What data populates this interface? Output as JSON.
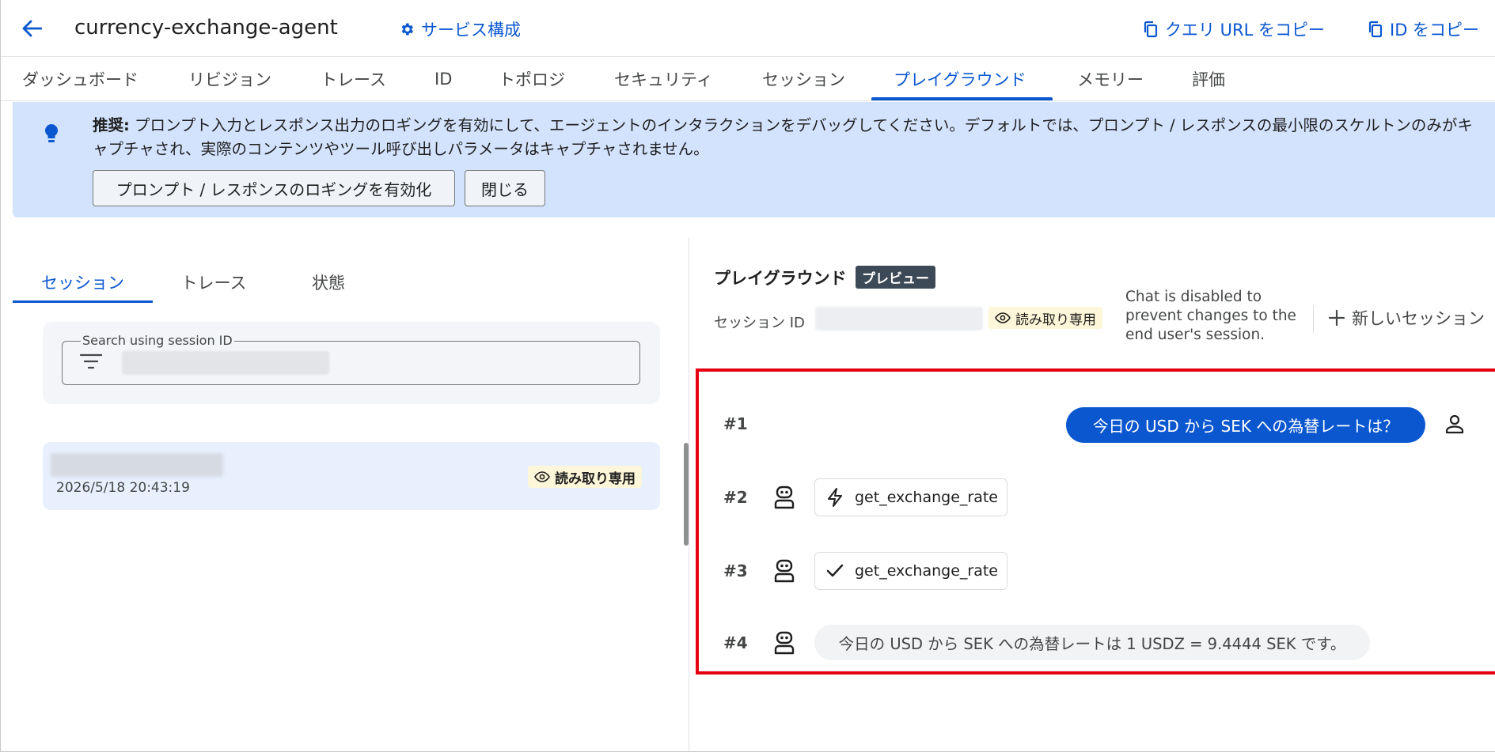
{
  "header": {
    "back_icon": "arrow-back-icon",
    "title": "currency-exchange-agent",
    "service_config": {
      "icon": "gear-icon",
      "label": "サービス構成"
    },
    "copy_query_url": {
      "icon": "copy-icon",
      "label": "クエリ URL をコピー"
    },
    "copy_id": {
      "icon": "copy-icon",
      "label": "ID をコピー"
    }
  },
  "tabs": [
    {
      "label": "ダッシュボード"
    },
    {
      "label": "リビジョン"
    },
    {
      "label": "トレース"
    },
    {
      "label": "ID"
    },
    {
      "label": "トポロジ"
    },
    {
      "label": "セキュリティ"
    },
    {
      "label": "セッション"
    },
    {
      "label": "プレイグラウンド",
      "active": true
    },
    {
      "label": "メモリー"
    },
    {
      "label": "評価"
    }
  ],
  "banner": {
    "icon": "lightbulb-icon",
    "lead": "推奨:",
    "text": " プロンプト入力とレスポンス出力のロギングを有効にして、エージェントのインタラクションをデバッグしてください。デフォルトでは、プロンプト / レスポンスの最小限のスケルトンのみがキャプチャされ、実際のコンテンツやツール呼び出しパラメータはキャプチャされません。",
    "enable_button": "プロンプト / レスポンスのロギングを有効化",
    "close_button": "閉じる"
  },
  "left": {
    "tabs": [
      {
        "label": "セッション",
        "active": true
      },
      {
        "label": "トレース"
      },
      {
        "label": "状態"
      }
    ],
    "search": {
      "label": "Search using session ID",
      "icon": "filter-icon",
      "value": ""
    },
    "sessions": [
      {
        "time": "2026/5/18 20:43:19",
        "badge": "読み取り専用",
        "badge_icon": "eye-icon"
      }
    ]
  },
  "right": {
    "title": "プレイグラウンド",
    "preview_badge": "プレビュー",
    "session_id_label": "セッション ID",
    "read_only_badge": "読み取り専用",
    "read_only_icon": "eye-icon",
    "chat_disabled": "Chat is disabled to prevent changes to the end user's session.",
    "new_session": {
      "icon": "plus-icon",
      "label": "新しいセッション"
    },
    "highlight_color": "#e50012",
    "turns": [
      {
        "num": "#1",
        "role": "user",
        "text": "今日の USD から SEK への為替レートは？"
      },
      {
        "num": "#2",
        "role": "agent",
        "type": "tool_call",
        "icon": "bolt-icon",
        "text": "get_exchange_rate"
      },
      {
        "num": "#3",
        "role": "agent",
        "type": "tool_result",
        "icon": "check-icon",
        "text": "get_exchange_rate"
      },
      {
        "num": "#4",
        "role": "agent",
        "type": "text",
        "text": "今日の USD から SEK への為替レートは 1 USDZ = 9.4444 SEK です。"
      }
    ]
  },
  "colors": {
    "accent": "#0b57d0",
    "banner_bg": "#d3e3fd",
    "badge_bg": "#fdf6d8",
    "preview_bg": "#3c4a57"
  }
}
